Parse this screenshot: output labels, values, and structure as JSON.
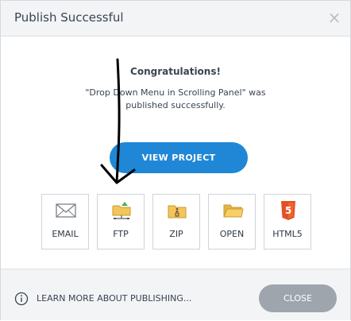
{
  "dialog": {
    "title": "Publish Successful",
    "close_icon": "close-icon"
  },
  "body": {
    "congrats": "Congratulations!",
    "message": "\"Drop Down Menu in Scrolling Panel\" was published successfully."
  },
  "actions": {
    "view_project": "VIEW PROJECT"
  },
  "options": [
    {
      "label": "EMAIL",
      "icon": "envelope-icon"
    },
    {
      "label": "FTP",
      "icon": "ftp-folder-icon"
    },
    {
      "label": "ZIP",
      "icon": "zip-folder-icon"
    },
    {
      "label": "OPEN",
      "icon": "folder-icon"
    },
    {
      "label": "HTML5",
      "icon": "html5-icon"
    }
  ],
  "footer": {
    "learn_more": "LEARN MORE ABOUT PUBLISHING...",
    "close_label": "CLOSE",
    "info_icon": "info-icon"
  },
  "colors": {
    "primary_button": "#1f87d6",
    "close_button": "#9ea5ad",
    "html5_orange": "#e34f26",
    "folder_yellow": "#f3c55b"
  }
}
